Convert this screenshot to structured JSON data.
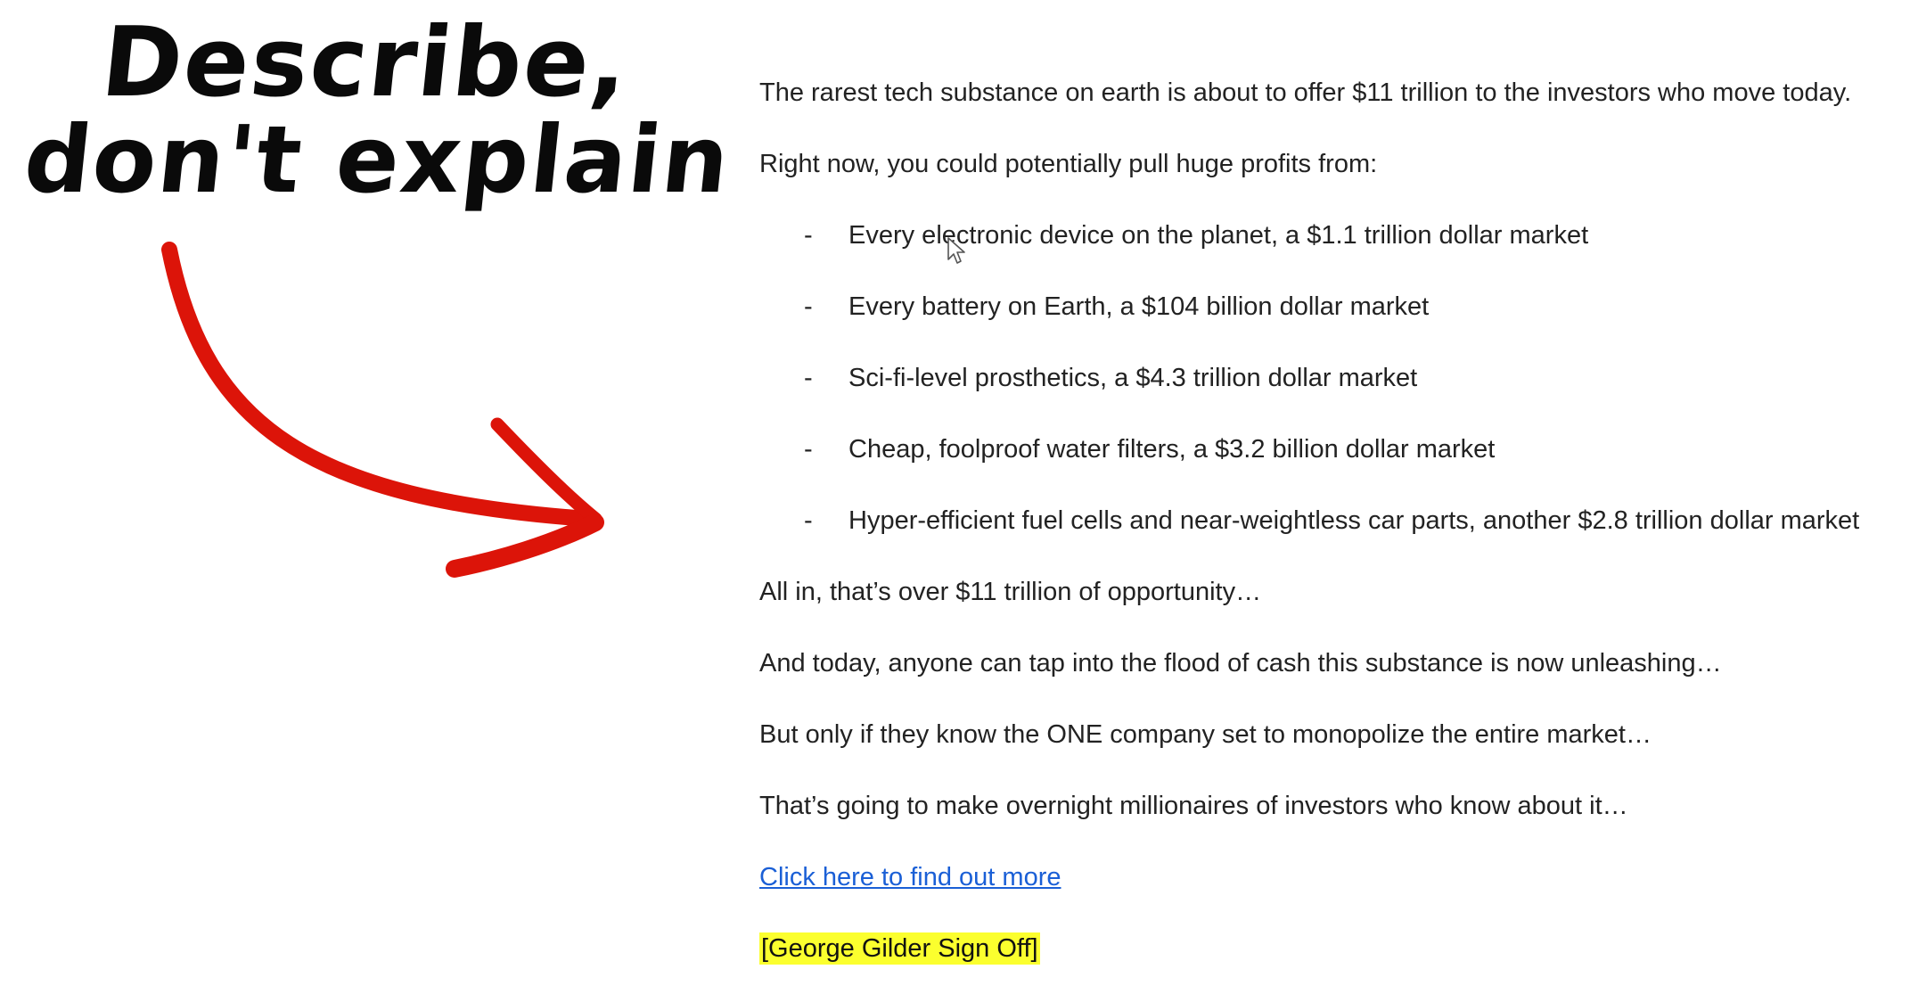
{
  "headline": {
    "line1": "Describe,",
    "line2": "don't explain"
  },
  "annotation": {
    "icon": "curved-arrow-icon",
    "color": "#dc1409"
  },
  "email": {
    "intro": "The rarest tech substance on earth is about to offer $11 trillion to the investors who move today.",
    "lead": "Right now, you could potentially pull huge profits from:",
    "bullet_marker": "-",
    "bullets": [
      "Every electronic device on the planet, a $1.1 trillion dollar market",
      "Every battery on Earth, a $104 billion dollar market",
      "Sci-fi-level prosthetics, a $4.3 trillion dollar market",
      "Cheap, foolproof water filters, a $3.2 billion dollar market",
      "Hyper-efficient fuel cells and near-weightless car parts, another $2.8 trillion dollar market"
    ],
    "para1": "All in, that’s over $11 trillion of opportunity…",
    "para2": "And today, anyone can tap into the flood of cash this substance is now unleashing…",
    "para3": "But only if they know the ONE company set to monopolize the entire market…",
    "para4": "That’s going to make overnight millionaires of investors who know about it…",
    "link_text": "Click here to find out more",
    "signoff": "[George Gilder Sign Off]"
  },
  "colors": {
    "link": "#1a5fd6",
    "highlight": "#fbff2e",
    "text": "#222222"
  }
}
